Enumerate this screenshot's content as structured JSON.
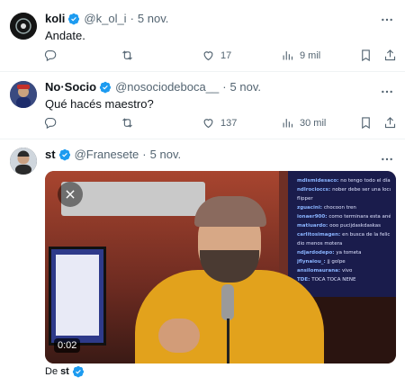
{
  "tweets": [
    {
      "name": "koli",
      "handle": "@k_ol_i",
      "date": "5 nov.",
      "text": "Andate.",
      "views": "9 mil",
      "replies": "",
      "retweets": "",
      "likes": "17"
    },
    {
      "name": "No·Socio",
      "handle": "@nosociodeboca__",
      "date": "5 nov.",
      "text": "Qué hacés maestro?",
      "replies": "",
      "retweets": "",
      "likes": "137",
      "views": "30 mil"
    },
    {
      "name": "st",
      "handle": "@Franesete",
      "date": "5 nov.",
      "video_time": "0:02",
      "from_label": "De",
      "from_name": "st",
      "chat": [
        {
          "user": "mdismidesaco:",
          "msg": "no tengo todo el día pues"
        },
        {
          "user": "ndlrocioccs:",
          "msg": "nober debe ser una locura en"
        },
        {
          "user": "",
          "msg": "flipper"
        },
        {
          "user": "zguacini:",
          "msg": "chocoon tren"
        },
        {
          "user": "ionaer900:",
          "msg": "como terminara esta anécu"
        },
        {
          "user": "matiuardo:",
          "msg": "ooo pucijdaskdaskas"
        },
        {
          "user": "carlitosimagen:",
          "msg": "en busca de la felicidad"
        },
        {
          "user": "",
          "msg": "dio menos motera"
        },
        {
          "user": "ndjardodepo:",
          "msg": "ya tometa"
        },
        {
          "user": "jflynaiou_:",
          "msg": "jj golpe"
        },
        {
          "user": "ansilomaurana:",
          "msg": "vivo"
        },
        {
          "user": "TDE:",
          "msg": "TOCA TOCA NENE"
        }
      ]
    }
  ],
  "colors": {
    "verified": "#1d9bf0",
    "text": "#0f1419",
    "muted": "#536471"
  }
}
